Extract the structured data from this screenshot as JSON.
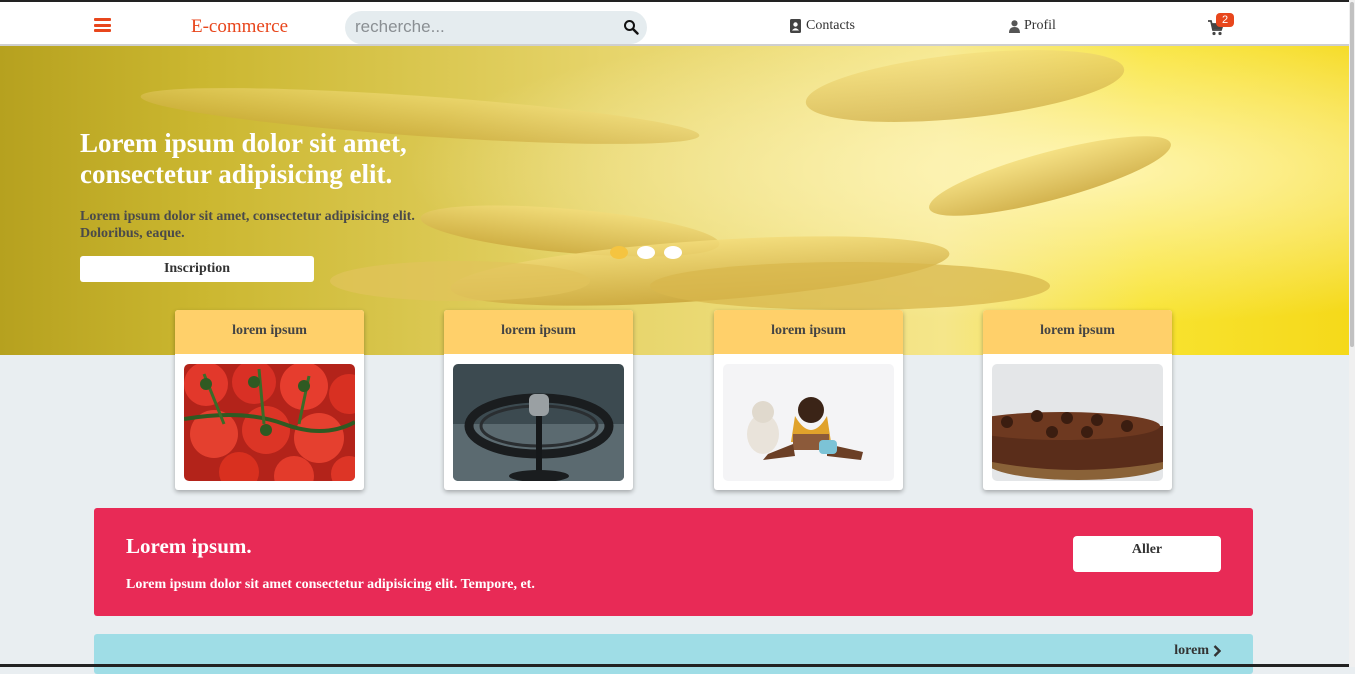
{
  "header": {
    "brand": "E-commerce",
    "search_placeholder": "recherche...",
    "contacts_label": "Contacts",
    "profil_label": "Profil",
    "cart_count": "2",
    "icons": [
      "menu-icon",
      "search-icon",
      "contacts-icon",
      "user-icon",
      "cart-icon"
    ]
  },
  "hero": {
    "title": "Lorem ipsum dolor sit amet, consectetur adipisicing elit.",
    "subtitle": "Lorem ipsum dolor sit amet, consectetur adipisicing elit. Doloribus, eaque.",
    "button_label": "Inscription",
    "slides": 3,
    "active_slide": 1
  },
  "cards": [
    {
      "title": "lorem ipsum",
      "image": "tomatoes"
    },
    {
      "title": "lorem ipsum",
      "image": "headphones"
    },
    {
      "title": "lorem ipsum",
      "image": "child"
    },
    {
      "title": "lorem ipsum",
      "image": "chocolate-cake"
    }
  ],
  "promo": {
    "title": "Lorem ipsum.",
    "text": "Lorem ipsum dolor sit amet consectetur adipisicing elit. Tempore, et.",
    "button_label": "Aller"
  },
  "bottom": {
    "link_label": "lorem"
  },
  "colors": {
    "accent": "#e8461c",
    "promo": "#e82a56",
    "card_header": "#ffc850",
    "bottom_bar": "#9fdde6",
    "background": "#e9eef1"
  }
}
